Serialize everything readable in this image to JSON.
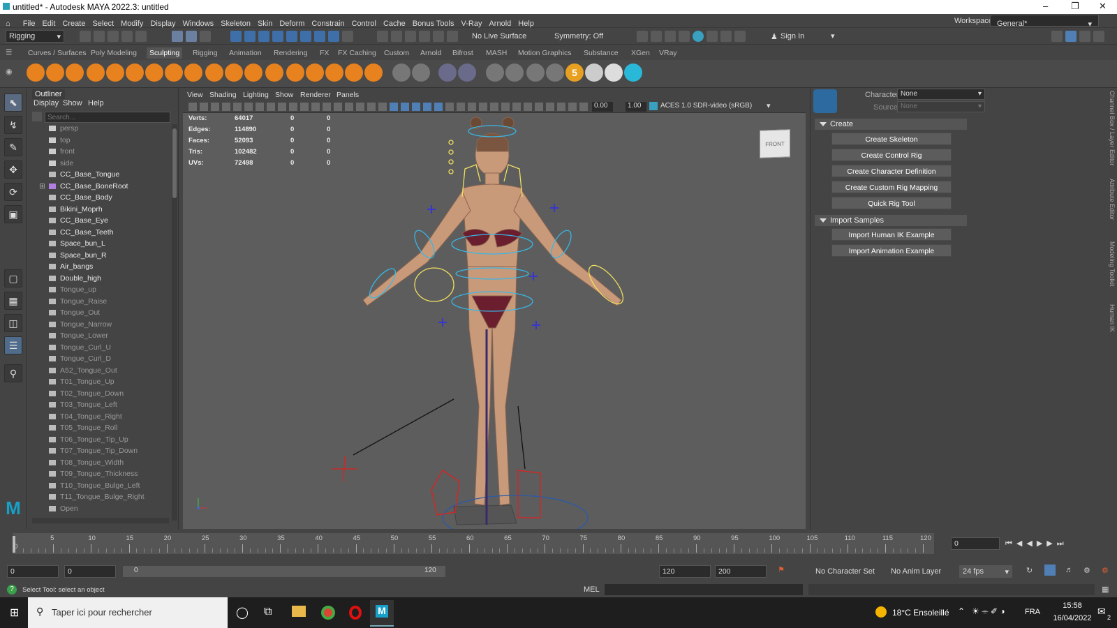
{
  "titlebar": {
    "title": "untitled* - Autodesk MAYA 2022.3: untitled"
  },
  "menu": {
    "items": [
      "File",
      "Edit",
      "Create",
      "Select",
      "Modify",
      "Display",
      "Windows",
      "Skeleton",
      "Skin",
      "Deform",
      "Constrain",
      "Control",
      "Cache",
      "Bonus Tools",
      "V-Ray",
      "Arnold",
      "Help"
    ],
    "workspace_label": "Workspace:",
    "workspace_value": "General*"
  },
  "statusline": {
    "mode": "Rigging",
    "live_surface": "No Live Surface",
    "symmetry": "Symmetry: Off",
    "sign_in": "Sign In"
  },
  "shelf": {
    "tabs": [
      "Curves / Surfaces",
      "Poly Modeling",
      "Sculpting",
      "Rigging",
      "Animation",
      "Rendering",
      "FX",
      "FX Caching",
      "Custom",
      "Arnold",
      "Bifrost",
      "MASH",
      "Motion Graphics",
      "Substance",
      "XGen",
      "VRay"
    ],
    "active": "Sculpting",
    "badge": "5"
  },
  "outliner": {
    "title": "Outliner",
    "menus": [
      "Display",
      "Show",
      "Help"
    ],
    "search_placeholder": "Search...",
    "items": [
      "persp",
      "top",
      "front",
      "side",
      "CC_Base_Tongue",
      "CC_Base_BoneRoot",
      "CC_Base_Body",
      "Bikini_Moprh",
      "CC_Base_Eye",
      "CC_Base_Teeth",
      "Space_bun_L",
      "Space_bun_R",
      "Air_bangs",
      "Double_high",
      "Tongue_up",
      "Tongue_Raise",
      "Tongue_Out",
      "Tongue_Narrow",
      "Tongue_Lower",
      "Tongue_Curl_U",
      "Tongue_Curl_D",
      "A52_Tongue_Out",
      "T01_Tongue_Up",
      "T02_Tongue_Down",
      "T03_Tongue_Left",
      "T04_Tongue_Right",
      "T05_Tongue_Roll",
      "T06_Tongue_Tip_Up",
      "T07_Tongue_Tip_Down",
      "T08_Tongue_Width",
      "T09_Tongue_Thickness",
      "T10_Tongue_Bulge_Left",
      "T11_Tongue_Bulge_Right",
      "Open"
    ]
  },
  "viewport": {
    "menus": [
      "View",
      "Shading",
      "Lighting",
      "Show",
      "Renderer",
      "Panels"
    ],
    "field_a": "0.00",
    "field_b": "1.00",
    "colorspace": "ACES 1.0 SDR-video (sRGB)",
    "viewcube": "FRONT",
    "hud": [
      {
        "label": "Verts:",
        "v": "64017",
        "a": "0",
        "b": "0"
      },
      {
        "label": "Edges:",
        "v": "114890",
        "a": "0",
        "b": "0"
      },
      {
        "label": "Faces:",
        "v": "52093",
        "a": "0",
        "b": "0"
      },
      {
        "label": "Tris:",
        "v": "102482",
        "a": "0",
        "b": "0"
      },
      {
        "label": "UVs:",
        "v": "72498",
        "a": "0",
        "b": "0"
      }
    ]
  },
  "hik": {
    "character_label": "Character:",
    "character_value": "None",
    "source_label": "Source:",
    "source_value": "None",
    "create_section": "Create",
    "create_buttons": [
      "Create Skeleton",
      "Create Control Rig",
      "Create Character Definition",
      "Create Custom Rig Mapping",
      "Quick Rig Tool"
    ],
    "import_section": "Import Samples",
    "import_buttons": [
      "Import Human IK Example",
      "Import Animation Example"
    ]
  },
  "side_tabs": [
    "Channel Box / Layer Editor",
    "Attribute Editor",
    "Modeling Toolkit",
    "Human IK"
  ],
  "timeline": {
    "labels": [
      "5",
      "10",
      "15",
      "20",
      "25",
      "30",
      "35",
      "40",
      "45",
      "50",
      "55",
      "60",
      "65",
      "70",
      "75",
      "80",
      "85",
      "90",
      "95",
      "100",
      "105",
      "110",
      "115",
      "120"
    ],
    "start": "0",
    "current": "0"
  },
  "range": {
    "start_outer": "0",
    "start_inner": "0",
    "slider_start": "0",
    "slider_end": "120",
    "end_inner": "120",
    "end_outer": "200",
    "character_set": "No Character Set",
    "anim_layer": "No Anim Layer",
    "fps": "24 fps"
  },
  "cmd": {
    "status": "Select Tool: select an object",
    "lang": "MEL"
  },
  "taskbar": {
    "search": "Taper ici pour rechercher",
    "weather": "18°C Ensoleillé",
    "lang": "FRA",
    "time": "15:58",
    "date": "16/04/2022",
    "notif": "2"
  }
}
